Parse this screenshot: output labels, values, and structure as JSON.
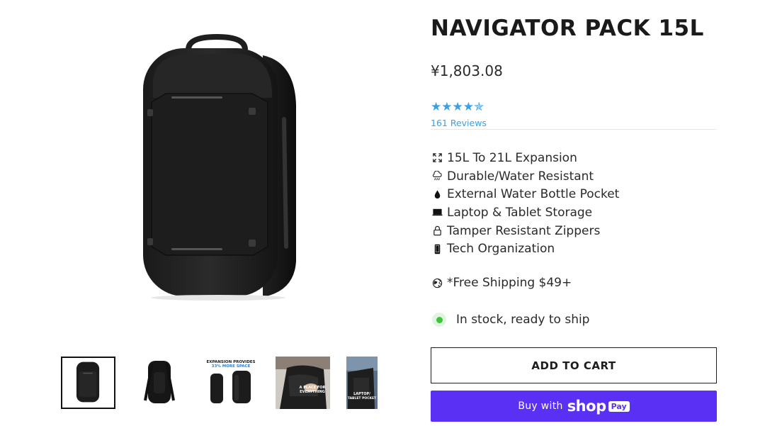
{
  "product": {
    "title": "NAVIGATOR PACK 15L",
    "price": "¥1,803.08",
    "rating": {
      "value": 4.5,
      "max": 5,
      "stars_display": "★★★★",
      "half_star": "✯",
      "reviews_label": "161 Reviews"
    }
  },
  "features": [
    {
      "icon": "expand-icon",
      "label": "15L To 21L Expansion"
    },
    {
      "icon": "rain-cloud-icon",
      "label": "Durable/Water Resistant"
    },
    {
      "icon": "water-drop-icon",
      "label": "External Water Bottle Pocket"
    },
    {
      "icon": "laptop-icon",
      "label": "Laptop & Tablet Storage"
    },
    {
      "icon": "lock-icon",
      "label": "Tamper Resistant Zippers"
    },
    {
      "icon": "phone-icon",
      "label": "Tech Organization"
    }
  ],
  "shipping": {
    "icon": "globe-icon",
    "label": "*Free Shipping $49+"
  },
  "stock": {
    "label": "In stock, ready to ship",
    "status_color": "#3cc43c"
  },
  "actions": {
    "add_to_cart": "ADD TO CART",
    "buy_with": "Buy with",
    "shop_word": "shop",
    "pay_word": "Pay",
    "shop_pay_color": "#5a31f4"
  },
  "gallery": {
    "thumbnails": [
      {
        "name": "thumb-front",
        "selected": true
      },
      {
        "name": "thumb-back",
        "selected": false
      },
      {
        "name": "thumb-expansion",
        "selected": false,
        "caption_line1": "EXPANSION PROVIDES",
        "caption_line2": "33% MORE SPACE"
      },
      {
        "name": "thumb-bottle-pocket",
        "selected": false,
        "caption_line1": "A PLACE FOR",
        "caption_line2": "EVERYTHING"
      },
      {
        "name": "thumb-laptop",
        "selected": false,
        "caption_line1": "LAPTOP/",
        "caption_line2": "TABLET POCKET"
      }
    ]
  },
  "colors": {
    "accent_blue": "#3aa0e6",
    "text": "#1c1c1c"
  }
}
